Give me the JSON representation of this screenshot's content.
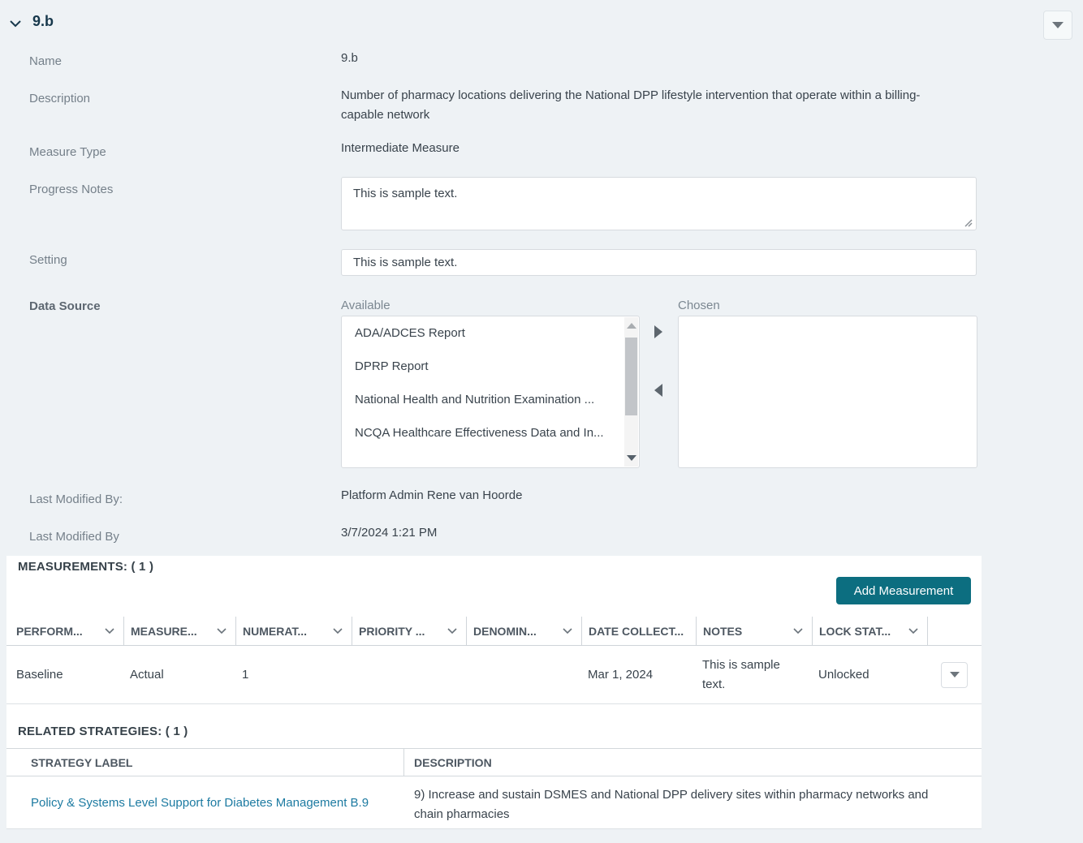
{
  "colors": {
    "page_bg": "#eef2f5",
    "accent_teal": "#0c6e80",
    "link": "#1c7aa1",
    "title": "#17384c"
  },
  "header": {
    "title": "9.b"
  },
  "form": {
    "name": {
      "label": "Name",
      "value": "9.b"
    },
    "description": {
      "label": "Description",
      "value": "Number of pharmacy locations delivering the National DPP lifestyle intervention that operate within a billing-capable network"
    },
    "measure_type": {
      "label": "Measure Type",
      "value": "Intermediate Measure"
    },
    "progress_notes": {
      "label": "Progress Notes",
      "value": "This is sample text."
    },
    "setting": {
      "label": "Setting",
      "value": "This is sample text."
    },
    "data_source": {
      "label": "Data Source",
      "available_label": "Available",
      "chosen_label": "Chosen",
      "available_items": [
        "ADA/ADCES Report",
        "DPRP Report",
        "National Health and Nutrition Examination ...",
        "NCQA Healthcare Effectiveness Data and In..."
      ],
      "chosen_items": []
    },
    "last_modified_by_user": {
      "label": "Last Modified By:",
      "value": "Platform Admin Rene van Hoorde"
    },
    "last_modified_date": {
      "label": "Last Modified By",
      "value": "3/7/2024 1:21 PM"
    }
  },
  "measurements": {
    "title": "MEASUREMENTS: ( 1 )",
    "add_button_label": "Add Measurement",
    "columns": [
      {
        "label": "PERFORM...",
        "sortable": true
      },
      {
        "label": "MEASURE...",
        "sortable": true
      },
      {
        "label": "NUMERAT...",
        "sortable": true
      },
      {
        "label": "PRIORITY ...",
        "sortable": true
      },
      {
        "label": "DENOMIN...",
        "sortable": true
      },
      {
        "label": "DATE COLLECT...",
        "sortable": false
      },
      {
        "label": "NOTES",
        "sortable": true
      },
      {
        "label": "LOCK STAT...",
        "sortable": true
      }
    ],
    "rows": [
      {
        "performance": "Baseline",
        "measure": "Actual",
        "numerator": "1",
        "priority": "",
        "denominator": "",
        "date_collected": "Mar 1, 2024",
        "notes": "This is sample text.",
        "lock_status": "Unlocked"
      }
    ]
  },
  "related_strategies": {
    "title": "RELATED STRATEGIES: ( 1 )",
    "columns": {
      "label": "STRATEGY LABEL",
      "description": "DESCRIPTION"
    },
    "rows": [
      {
        "strategy_label": "Policy & Systems Level Support for Diabetes Management B.9",
        "description": "9) Increase and sustain DSMES and National DPP delivery sites within pharmacy networks and chain pharmacies"
      }
    ]
  }
}
